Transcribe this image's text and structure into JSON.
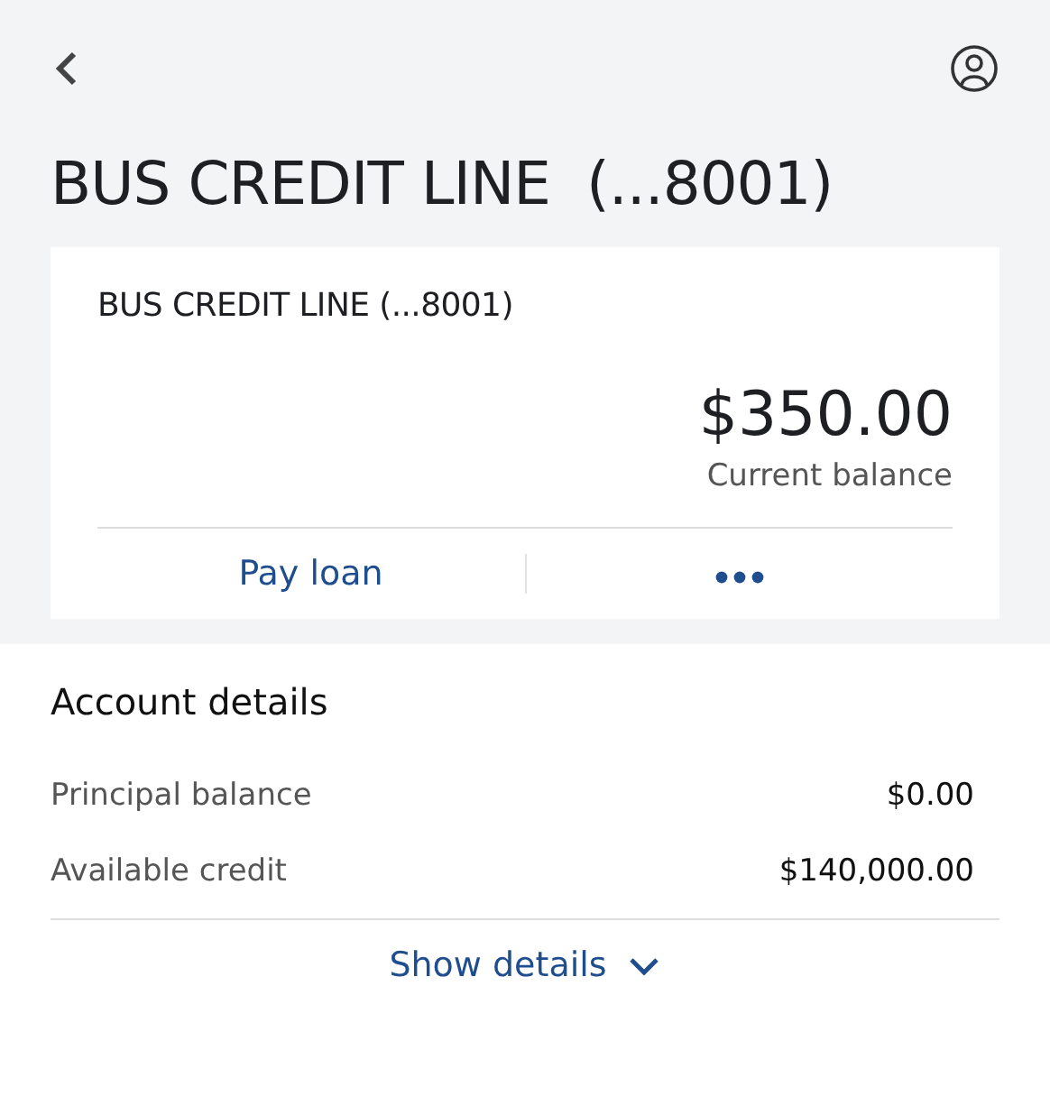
{
  "header": {
    "title": "BUS CREDIT LINE  (...8001)"
  },
  "card": {
    "name": "BUS CREDIT LINE (...8001)",
    "balance": "$350.00",
    "balance_label": "Current balance",
    "action": "Pay loan"
  },
  "details": {
    "title": "Account details",
    "rows": [
      {
        "label": "Principal balance",
        "value": "$0.00"
      },
      {
        "label": "Available credit",
        "value": "$140,000.00"
      }
    ],
    "toggle": "Show details"
  }
}
